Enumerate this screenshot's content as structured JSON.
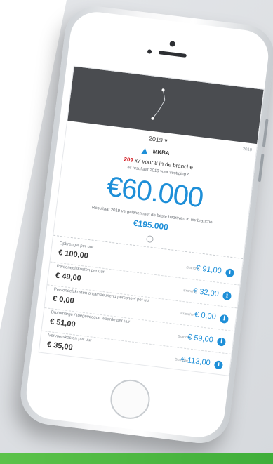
{
  "colors": {
    "accent": "#1e8fd8",
    "alert": "#d6242a",
    "brand_green": "#4cb844"
  },
  "screen": {
    "year": "2019 ▾",
    "year_right": "2019",
    "company": "MKBA",
    "alert_number": "209",
    "alert_text": "x7 voor 8 in de branche",
    "alert_caption": "Uw resultaat 2019 voor vestiging A",
    "big_amount": "€60.000",
    "big_caption": "Resultaat 2019 vergeleken met de beste bedrijven in uw branche",
    "second_amount": "€195.000",
    "rows": [
      {
        "label": "Opbrengst per uur",
        "value": "€ 100,00",
        "right_label": "Branche",
        "right_value": "€ 91,00"
      },
      {
        "label": "Personeelskosten per uur",
        "value": "€ 49,00",
        "right_label": "Branche",
        "right_value": "€ 32,00"
      },
      {
        "label": "Personeelskosten ondersteunend personeel per uur",
        "value": "€ 0,00",
        "right_label": "Branche",
        "right_value": "€ 0,00"
      },
      {
        "label": "Brutomarge / toegevoegde waarde per uur",
        "value": "€ 51,00",
        "right_label": "Branche",
        "right_value": "€ 59,00"
      },
      {
        "label": "Vervoerskosten per uur",
        "value": "€ 35,00",
        "right_label": "Branche",
        "right_value": "€ 113,00"
      }
    ]
  }
}
